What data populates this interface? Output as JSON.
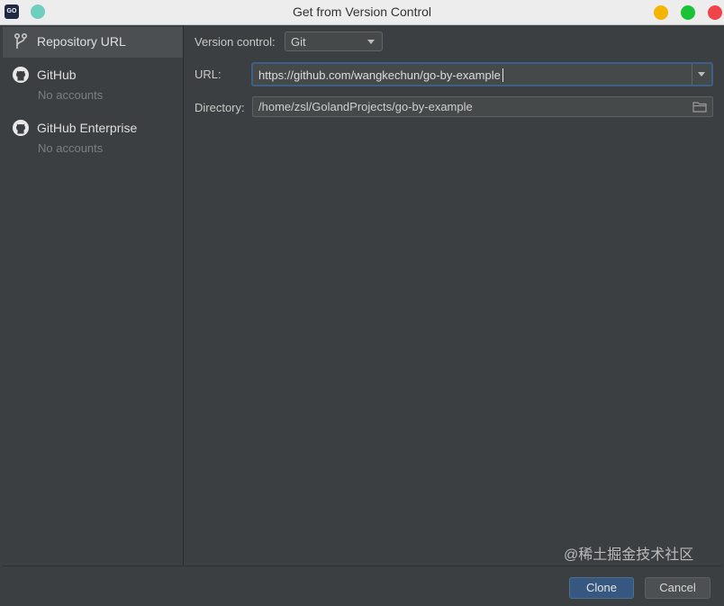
{
  "window": {
    "title": "Get from Version Control",
    "app_icon": "go-icon",
    "app_icon_text": "GO"
  },
  "sidebar": {
    "items": [
      {
        "label": "Repository URL",
        "icon": "branch-icon",
        "selected": true
      },
      {
        "label": "GitHub",
        "sub": "No accounts",
        "icon": "github-icon"
      },
      {
        "label": "GitHub Enterprise",
        "sub": "No accounts",
        "icon": "github-icon"
      }
    ]
  },
  "form": {
    "version_control_label": "Version control:",
    "version_control_value": "Git",
    "url_label": "URL:",
    "url_value": "https://github.com/wangkechun/go-by-example",
    "directory_label": "Directory:",
    "directory_value": "/home/zsl/GolandProjects/go-by-example"
  },
  "buttons": {
    "clone": "Clone",
    "cancel": "Cancel"
  },
  "watermark": "@稀土掘金技术社区",
  "colors": {
    "accent": "#365880",
    "focus_border": "#3d6185",
    "background": "#3c3f41",
    "close": "#f0434a",
    "minimize": "#f4b400",
    "maximize": "#18c336"
  }
}
